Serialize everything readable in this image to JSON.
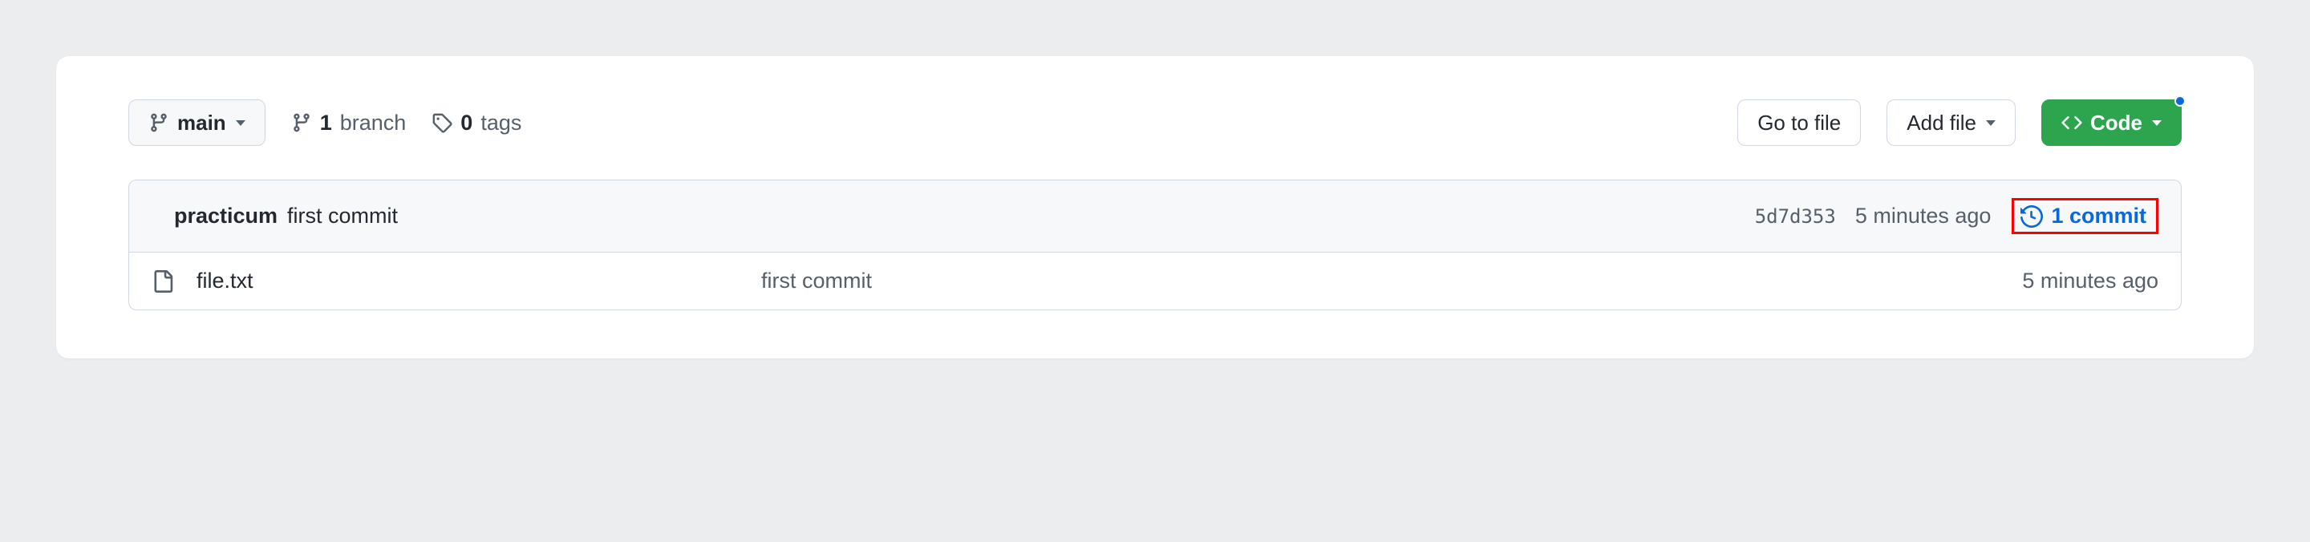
{
  "branch": {
    "label": "main"
  },
  "stats": {
    "branches": {
      "count": "1",
      "label": "branch"
    },
    "tags": {
      "count": "0",
      "label": "tags"
    }
  },
  "actions": {
    "goToFile": "Go to file",
    "addFile": "Add file",
    "code": "Code"
  },
  "latestCommit": {
    "author": "practicum",
    "message": "first commit",
    "sha": "5d7d353",
    "time": "5 minutes ago",
    "historyLabel": "1 commit"
  },
  "files": [
    {
      "name": "file.txt",
      "message": "first commit",
      "time": "5 minutes ago"
    }
  ]
}
